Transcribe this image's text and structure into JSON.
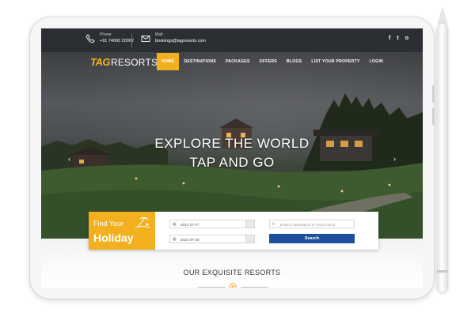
{
  "topbar": {
    "phone_label": "Phone:",
    "phone_value": "+91 74000 20002",
    "mail_label": "Mail:",
    "mail_value": "bookings@tagresorts.com",
    "social": [
      "f",
      "t",
      "o"
    ]
  },
  "brand": {
    "logo_tag": "TAG",
    "logo_rest": "RESORTS"
  },
  "nav": {
    "items": [
      "HOME",
      "DESTINATIONS",
      "PACKAGES",
      "OFFERS",
      "BLOGS",
      "LIST YOUR PROPERTY",
      "LOGIN"
    ],
    "active": "HOME"
  },
  "hero": {
    "line1": "EXPLORE THE WORLD",
    "line2": "TAP AND GO",
    "prev": "‹",
    "next": "›"
  },
  "finder": {
    "title_small": "Find Your",
    "title_big": "Holiday",
    "checkin": "2021-07-27",
    "checkout": "2021-07-28",
    "destination_placeholder": "Enter a destination or resort name",
    "search_label": "Search"
  },
  "section": {
    "title": "OUR EXQUISITE RESORTS"
  },
  "colors": {
    "accent": "#f2b01e",
    "button": "#1e4f9c",
    "topbar": "#2b2e33"
  },
  "icons": [
    "phone-icon",
    "mail-icon",
    "facebook-icon",
    "twitter-icon",
    "instagram-icon",
    "calendar-icon",
    "location-icon",
    "beach-icon",
    "chevron-left-icon",
    "chevron-right-icon"
  ]
}
